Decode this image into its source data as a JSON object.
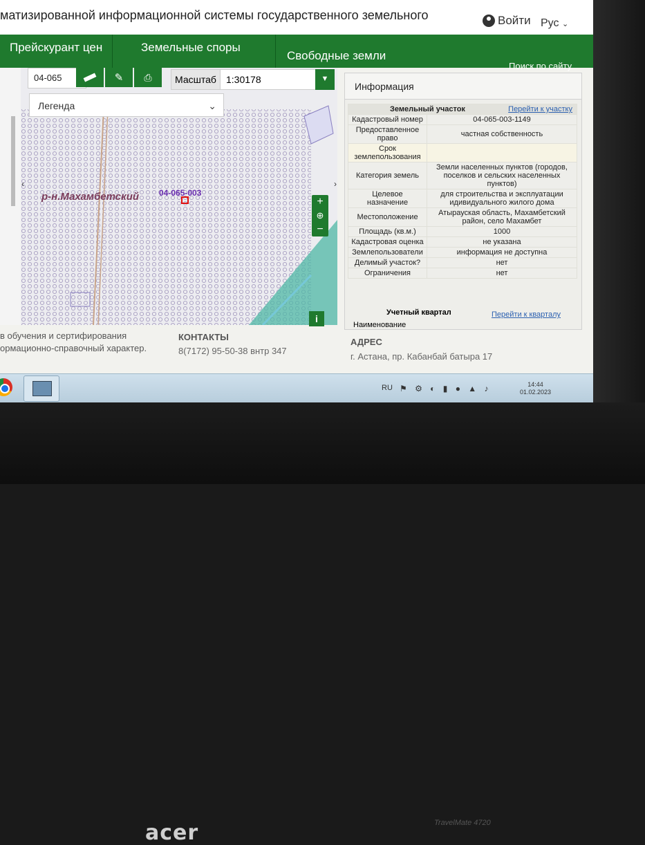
{
  "header": {
    "title": "матизированной информационной системы государственного земельного",
    "login": "Войти",
    "lang": "Рус"
  },
  "nav": {
    "items": [
      "Прейскурант цен",
      "Земельные споры",
      "Свободные земли"
    ],
    "search": "Поиск по сайту"
  },
  "map": {
    "code": "04-065",
    "scale_label": "Масштаб",
    "scale_value": "1:30178",
    "legend": "Легенда",
    "district_label": "р-н.Махамбетский",
    "parcel_label": "04-065-003",
    "zoom_plus": "+",
    "zoom_globe": "⊕",
    "zoom_minus": "−",
    "info_button": "i"
  },
  "info": {
    "title": "Информация",
    "section": "Земельный участок",
    "section_link": "Перейти к участку",
    "rows": [
      {
        "k": "Кадастровый номер",
        "v": "04-065-003-1149"
      },
      {
        "k": "Предоставленное право",
        "v": "частная собственность"
      },
      {
        "k": "Срок землепользования",
        "v": ""
      },
      {
        "k": "Категория земель",
        "v": "Земли населенных пунктов (городов, поселков и сельских населенных пунктов)"
      },
      {
        "k": "Целевое назначение",
        "v": "для строительства и эксплуатации идивидуального жилого дома"
      },
      {
        "k": "Местоположение",
        "v": "Атырауская область, Махамбетский район, село Махамбет"
      },
      {
        "k": "Площадь (кв.м.)",
        "v": "1000"
      },
      {
        "k": "Кадастровая оценка",
        "v": "не указана"
      },
      {
        "k": "Землепользователи",
        "v": "информация не доступна"
      },
      {
        "k": "Делимый участок?",
        "v": "нет"
      },
      {
        "k": "Ограничения",
        "v": "нет"
      }
    ],
    "quarter_title": "Учетный квартал",
    "quarter_link": "Перейти к кварталу",
    "quarter_name": "Наименование"
  },
  "footer": {
    "line1": "в обучения и сертифирования",
    "line2": "ормационно-справочный характер.",
    "contacts": "КОНТАКТЫ",
    "phone": "8(7172) 95-50-38 внтр 347",
    "address_label": "АДРЕС",
    "address": "г. Астана, пр. Кабанбай батыра 17"
  },
  "taskbar": {
    "lang": "RU",
    "time": "14:44",
    "date": "01.02.2023"
  },
  "device": {
    "brand": "acer",
    "model": "TravelMate 4720"
  }
}
